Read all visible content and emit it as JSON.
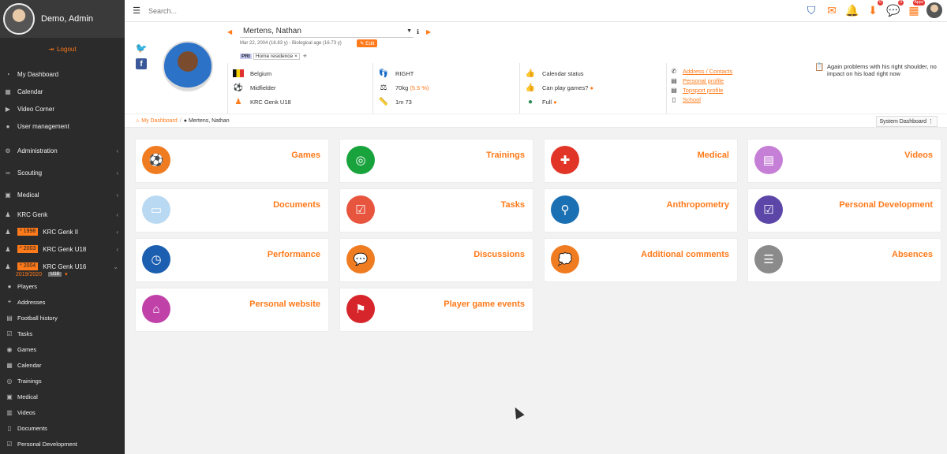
{
  "sidebar": {
    "user_name": "Demo, Admin",
    "logout": "Logout",
    "items": [
      {
        "label": "My Dashboard",
        "icon": "dashboard-icon"
      },
      {
        "label": "Calendar",
        "icon": "calendar-icon"
      },
      {
        "label": "Video Corner",
        "icon": "video-icon"
      },
      {
        "label": "User management",
        "icon": "user-icon"
      }
    ],
    "groups": [
      {
        "label": "Administration",
        "icon": "gear-icon"
      },
      {
        "label": "Scouting",
        "icon": "binoculars-icon"
      },
      {
        "label": "Medical",
        "icon": "medkit-icon"
      }
    ],
    "teams": [
      {
        "label": "KRC Genk",
        "badge": ""
      },
      {
        "label": "KRC Genk II",
        "badge": "* 1998"
      },
      {
        "label": "KRC Genk U18",
        "badge": "* 2003"
      },
      {
        "label": "KRC Genk U16",
        "badge": "* 2004"
      }
    ],
    "season": "2019/2020",
    "season_tag": "U16",
    "subitems": [
      {
        "label": "Players",
        "icon": "player-icon"
      },
      {
        "label": "Addresses",
        "icon": "map-pin-icon"
      },
      {
        "label": "Football history",
        "icon": "history-icon"
      },
      {
        "label": "Tasks",
        "icon": "tasks-icon"
      },
      {
        "label": "Games",
        "icon": "ball-icon"
      },
      {
        "label": "Calendar",
        "icon": "calendar-icon"
      },
      {
        "label": "Trainings",
        "icon": "lifebuoy-icon"
      },
      {
        "label": "Medical",
        "icon": "medkit-icon"
      },
      {
        "label": "Videos",
        "icon": "film-icon"
      },
      {
        "label": "Documents",
        "icon": "document-icon"
      },
      {
        "label": "Personal Development",
        "icon": "development-icon"
      }
    ]
  },
  "topbar": {
    "search_placeholder": "Search...",
    "badges": {
      "downloads": "0",
      "chat": "0",
      "apps": "Apps"
    }
  },
  "player": {
    "name": "Mertens, Nathan",
    "dob_line": "Mar 22, 2004 (16.83 y) - Biological age (16.73 y)",
    "edit": "Edit",
    "pri": "PRI",
    "tag": "Home residence",
    "tag_x": "×",
    "add_tag": "+",
    "country": "Belgium",
    "position": "Midfielder",
    "team": "KRC Genk U18",
    "foot": "RIGHT",
    "weight": "70kg",
    "weight_pct": "(5.5 %)",
    "height": "1m 73",
    "calendar_status": "Calendar status",
    "can_play": "Can play games?",
    "full": "Full",
    "links": [
      "Address / Contacts",
      "Personal profile",
      "Topsport profile",
      "School"
    ],
    "note": "Again problems with his right shoulder, no impact on his load right now"
  },
  "breadcrumb": {
    "home": "My Dashboard",
    "sep": "/",
    "current": "Mertens, Nathan",
    "system": "System Dashboard"
  },
  "tiles": [
    {
      "title": "Games",
      "color": "#f07c22",
      "icon": "ball-icon",
      "glyph": "⚽"
    },
    {
      "title": "Trainings",
      "color": "#19a33d",
      "icon": "lifebuoy-icon",
      "glyph": "◎"
    },
    {
      "title": "Medical",
      "color": "#e03527",
      "icon": "medkit-icon",
      "glyph": "✚"
    },
    {
      "title": "Videos",
      "color": "#c67fd6",
      "icon": "film-icon",
      "glyph": "▤"
    },
    {
      "title": "Documents",
      "color": "#b9d9f2",
      "icon": "document-icon",
      "glyph": "▭"
    },
    {
      "title": "Tasks",
      "color": "#e8553f",
      "icon": "tasks-icon",
      "glyph": "☑"
    },
    {
      "title": "Anthropometry",
      "color": "#1b6fb3",
      "icon": "anthropometry-icon",
      "glyph": "⚲"
    },
    {
      "title": "Personal Development",
      "color": "#5c47a8",
      "icon": "development-icon",
      "glyph": "☑"
    },
    {
      "title": "Performance",
      "color": "#1c5fb0",
      "icon": "stopwatch-icon",
      "glyph": "◷"
    },
    {
      "title": "Discussions",
      "color": "#f07c22",
      "icon": "chat-icon",
      "glyph": "💬"
    },
    {
      "title": "Additional comments",
      "color": "#f07c22",
      "icon": "comment-icon",
      "glyph": "💭"
    },
    {
      "title": "Absences",
      "color": "#8b8b8b",
      "icon": "clipboard-icon",
      "glyph": "☰"
    },
    {
      "title": "Personal website",
      "color": "#c042a8",
      "icon": "home-icon",
      "glyph": "⌂"
    },
    {
      "title": "Player game events",
      "color": "#d6262b",
      "icon": "tags-icon",
      "glyph": "⚑"
    }
  ]
}
